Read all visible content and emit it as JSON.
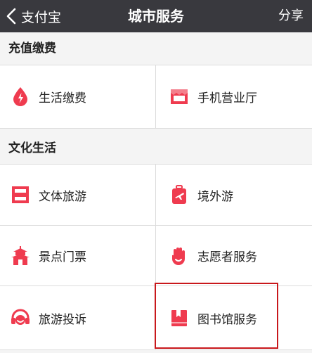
{
  "navbar": {
    "back_label": "支付宝",
    "title": "城市服务",
    "share_label": "分享"
  },
  "sections": [
    {
      "title": "充值缴费",
      "items": [
        {
          "label": "生活缴费",
          "icon": "water-drop-icon"
        },
        {
          "label": "手机营业厅",
          "icon": "storefront-icon"
        }
      ]
    },
    {
      "title": "文化生活",
      "items": [
        {
          "label": "文体旅游",
          "icon": "grid-frame-icon"
        },
        {
          "label": "境外游",
          "icon": "luggage-plane-icon"
        },
        {
          "label": "景点门票",
          "icon": "pagoda-icon"
        },
        {
          "label": "志愿者服务",
          "icon": "raised-hand-icon"
        },
        {
          "label": "旅游投诉",
          "icon": "headset-icon"
        },
        {
          "label": "图书馆服务",
          "icon": "bookmark-book-icon"
        }
      ]
    }
  ],
  "colors": {
    "navbar_bg": "#39393e",
    "icon_red": "#ef3b4f",
    "highlight_border": "#c8181c"
  }
}
